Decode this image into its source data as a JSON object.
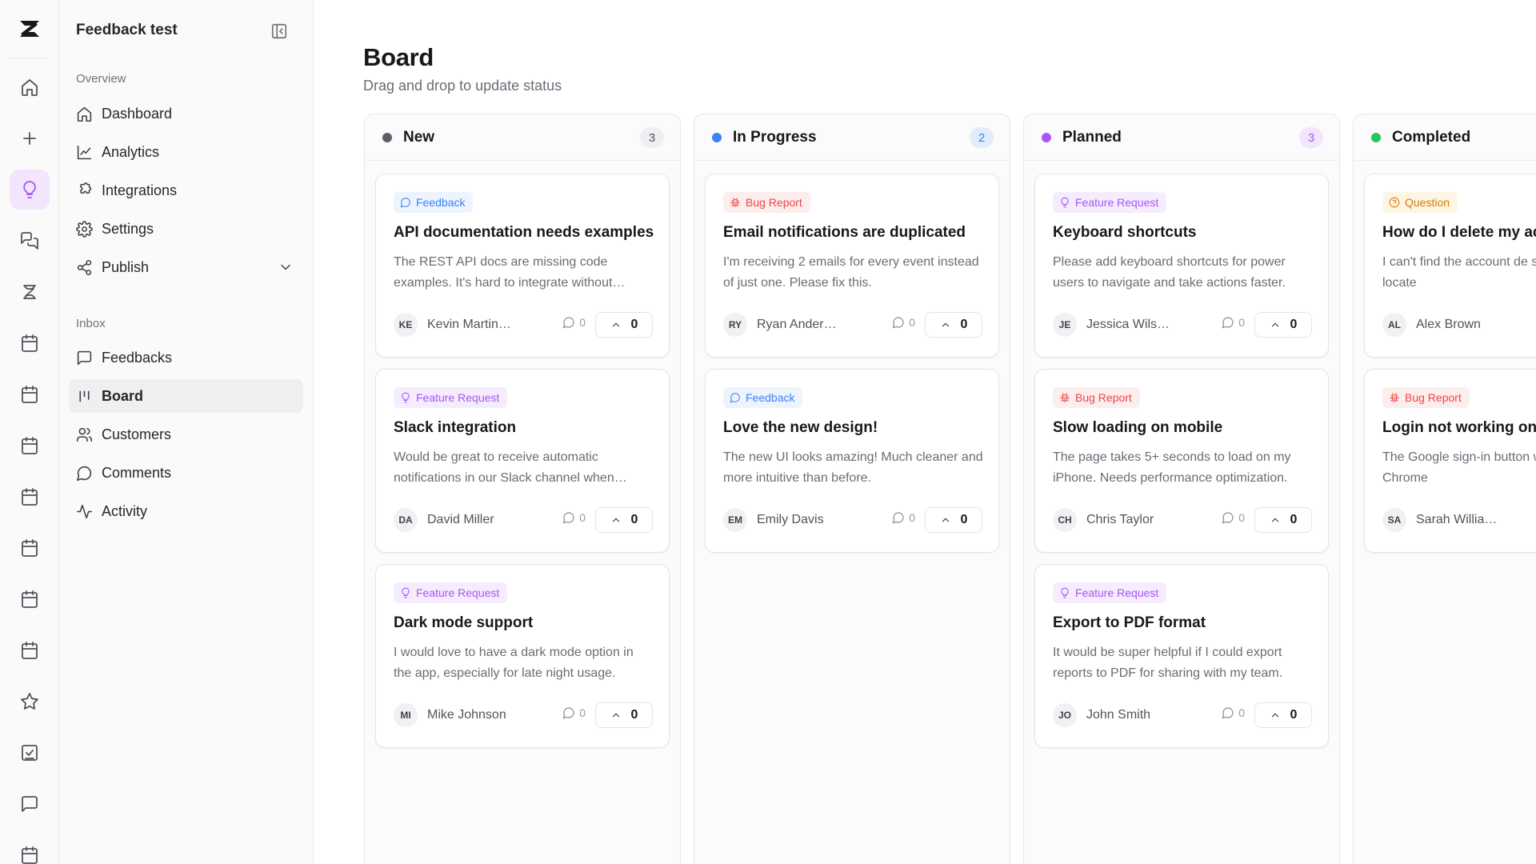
{
  "workspace": {
    "title": "Feedback test"
  },
  "rail": {
    "items": [
      {
        "icon": "home-icon",
        "name": "rail-home-button"
      },
      {
        "icon": "plus-icon",
        "name": "rail-add-button"
      },
      {
        "icon": "lightbulb-icon",
        "name": "rail-feedback-button",
        "active": true
      },
      {
        "icon": "messages-icon",
        "name": "rail-messages-button"
      },
      {
        "icon": "brand-icon",
        "name": "rail-brand-button"
      },
      {
        "icon": "calendar-icon",
        "name": "rail-calendar-button-1"
      },
      {
        "icon": "calendar-icon",
        "name": "rail-calendar-button-2"
      },
      {
        "icon": "calendar-icon",
        "name": "rail-calendar-button-3"
      },
      {
        "icon": "calendar-icon",
        "name": "rail-calendar-button-4"
      },
      {
        "icon": "calendar-icon",
        "name": "rail-calendar-button-5"
      },
      {
        "icon": "calendar-icon",
        "name": "rail-calendar-button-6"
      },
      {
        "icon": "calendar-icon",
        "name": "rail-calendar-button-7"
      },
      {
        "icon": "star-icon",
        "name": "rail-star-button"
      },
      {
        "icon": "checklist-icon",
        "name": "rail-tasks-button"
      },
      {
        "icon": "chat-icon",
        "name": "rail-chat-button"
      },
      {
        "icon": "calendar-icon",
        "name": "rail-calendar-button-8"
      }
    ]
  },
  "sidebar": {
    "overview_label": "Overview",
    "inbox_label": "Inbox",
    "overview": [
      {
        "label": "Dashboard",
        "icon": "home-icon"
      },
      {
        "label": "Analytics",
        "icon": "line-chart-icon"
      },
      {
        "label": "Integrations",
        "icon": "puzzle-icon"
      },
      {
        "label": "Settings",
        "icon": "gear-icon"
      },
      {
        "label": "Publish",
        "icon": "share-icon"
      }
    ],
    "inbox": [
      {
        "label": "Feedbacks",
        "icon": "message-square-icon"
      },
      {
        "label": "Board",
        "icon": "kanban-icon",
        "active": true
      },
      {
        "label": "Customers",
        "icon": "users-icon"
      },
      {
        "label": "Comments",
        "icon": "message-circle-icon"
      },
      {
        "label": "Activity",
        "icon": "activity-icon"
      }
    ]
  },
  "main": {
    "title": "Board",
    "subtitle": "Drag and drop to update status"
  },
  "colors": {
    "new": "#71717a",
    "in_progress": "#3b82f6",
    "planned": "#a855f7",
    "completed": "#22c55e"
  },
  "columns": [
    {
      "name": "New",
      "count": "3",
      "color": "#5f5f68",
      "cards": [
        {
          "tag": "Feedback",
          "tag_type": "feedback",
          "title": "API documentation needs examples",
          "desc": "The REST API docs are missing code examples. It's hard to integrate without…",
          "initials": "KE",
          "author": "Kevin Martin…",
          "comments": "0",
          "votes": "0"
        },
        {
          "tag": "Feature Request",
          "tag_type": "feature",
          "title": "Slack integration",
          "desc": "Would be great to receive automatic notifications in our Slack channel when…",
          "initials": "DA",
          "author": "David Miller",
          "comments": "0",
          "votes": "0"
        },
        {
          "tag": "Feature Request",
          "tag_type": "feature",
          "title": "Dark mode support",
          "desc": "I would love to have a dark mode option in the app, especially for late night usage.",
          "initials": "MI",
          "author": "Mike Johnson",
          "comments": "0",
          "votes": "0"
        }
      ]
    },
    {
      "name": "In Progress",
      "count": "2",
      "color": "#3b82f6",
      "cards": [
        {
          "tag": "Bug Report",
          "tag_type": "bug",
          "title": "Email notifications are duplicated",
          "desc": "I'm receiving 2 emails for every event instead of just one. Please fix this.",
          "initials": "RY",
          "author": "Ryan Ander…",
          "comments": "0",
          "votes": "0"
        },
        {
          "tag": "Feedback",
          "tag_type": "feedback",
          "title": "Love the new design!",
          "desc": "The new UI looks amazing! Much cleaner and more intuitive than before.",
          "initials": "EM",
          "author": "Emily Davis",
          "comments": "0",
          "votes": "0"
        }
      ]
    },
    {
      "name": "Planned",
      "count": "3",
      "color": "#a855f7",
      "cards": [
        {
          "tag": "Feature Request",
          "tag_type": "feature",
          "title": "Keyboard shortcuts",
          "desc": "Please add keyboard shortcuts for power users to navigate and take actions faster.",
          "initials": "JE",
          "author": "Jessica Wils…",
          "comments": "0",
          "votes": "0"
        },
        {
          "tag": "Bug Report",
          "tag_type": "bug",
          "title": "Slow loading on mobile",
          "desc": "The page takes 5+ seconds to load on my iPhone. Needs performance optimization.",
          "initials": "CH",
          "author": "Chris Taylor",
          "comments": "0",
          "votes": "0"
        },
        {
          "tag": "Feature Request",
          "tag_type": "feature",
          "title": "Export to PDF format",
          "desc": "It would be super helpful if I could export reports to PDF for sharing with my team.",
          "initials": "JO",
          "author": "John Smith",
          "comments": "0",
          "votes": "0"
        }
      ]
    },
    {
      "name": "Completed",
      "count": "",
      "color": "#22c55e",
      "cards": [
        {
          "tag": "Question",
          "tag_type": "question",
          "title": "How do I delete my ac",
          "desc": "I can't find the account de settings. Where is it locate",
          "initials": "AL",
          "author": "Alex Brown",
          "comments": "",
          "votes": ""
        },
        {
          "tag": "Bug Report",
          "tag_type": "bug",
          "title": "Login not working on",
          "desc": "The Google sign-in button when I click it on Chrome",
          "initials": "SA",
          "author": "Sarah Willia…",
          "comments": "",
          "votes": ""
        }
      ]
    }
  ]
}
